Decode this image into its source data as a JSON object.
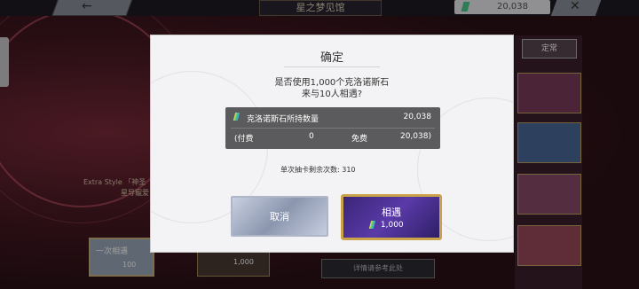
{
  "background": {
    "title": "星之梦见馆",
    "gems_value": "20,038",
    "right_tab": "定常",
    "bottom_btn1": "一次相遇",
    "bottom_btn1_cost": "100",
    "bottom_btn2_cost": "1,000",
    "bottom_btn3": "详情请参考此处",
    "label1": "Extra Style 「神圣",
    "label2": "星导寵爱"
  },
  "modal": {
    "title": "确定",
    "question_line1": "是否使用1,000个克洛诺斯石",
    "question_line2": "来与10人相遇?",
    "owned_label": "克洛诺斯石所持数量",
    "owned_value": "20,038",
    "paid_label": "(付费",
    "paid_value": "0",
    "free_label": "免费",
    "free_value": "20,038)",
    "draws_remaining": "单次抽卡剩余次数:  310",
    "cancel_label": "取消",
    "summon_label": "相遇",
    "summon_cost": "1,000"
  },
  "colors": {
    "gem": "#49c88a",
    "summon_border": "#c9a24a",
    "info_box": "#5b5b5d"
  }
}
